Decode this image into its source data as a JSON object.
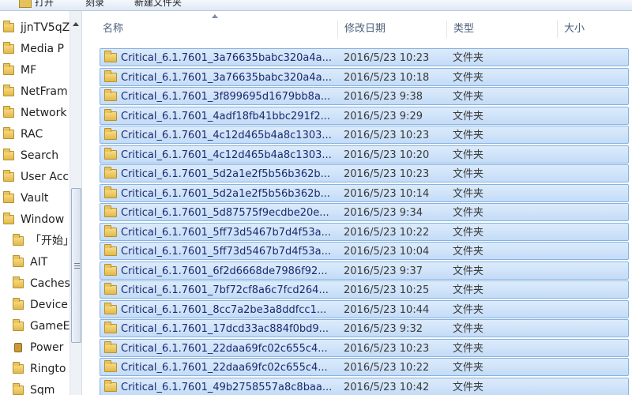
{
  "toolbar": {
    "open_label": "打开",
    "burn_label": "刻录",
    "new_folder_label": "新建文件夹"
  },
  "nav": {
    "items": [
      {
        "label": "jjnTV5qZ",
        "icon": "folder-icon",
        "level": 0
      },
      {
        "label": "Media P",
        "icon": "folder-icon",
        "level": 0
      },
      {
        "label": "MF",
        "icon": "folder-icon",
        "level": 0
      },
      {
        "label": "NetFram",
        "icon": "folder-icon",
        "level": 0
      },
      {
        "label": "Network",
        "icon": "folder-icon",
        "level": 0
      },
      {
        "label": "RAC",
        "icon": "folder-icon",
        "level": 0
      },
      {
        "label": "Search",
        "icon": "folder-icon",
        "level": 0
      },
      {
        "label": "User Acc",
        "icon": "folder-icon",
        "level": 0
      },
      {
        "label": "Vault",
        "icon": "folder-icon",
        "level": 0
      },
      {
        "label": "Window",
        "icon": "folder-icon",
        "level": 0
      },
      {
        "label": "「开始」",
        "icon": "folder-icon",
        "level": 1
      },
      {
        "label": "AIT",
        "icon": "folder-icon",
        "level": 1
      },
      {
        "label": "Caches",
        "icon": "folder-icon",
        "level": 1
      },
      {
        "label": "Device",
        "icon": "folder-icon",
        "level": 1
      },
      {
        "label": "GameE",
        "icon": "folder-icon",
        "level": 1
      },
      {
        "label": "Power",
        "icon": "locked-folder-icon",
        "level": 1
      },
      {
        "label": "Ringto",
        "icon": "folder-icon",
        "level": 1
      },
      {
        "label": "Sqm",
        "icon": "folder-icon",
        "level": 1
      }
    ]
  },
  "columns": {
    "name": "名称",
    "date": "修改日期",
    "type": "类型",
    "size": "大小"
  },
  "files": [
    {
      "name": "Critical_6.1.7601_3a76635babc320a4a...",
      "date": "2016/5/23 10:23",
      "type": "文件夹"
    },
    {
      "name": "Critical_6.1.7601_3a76635babc320a4a...",
      "date": "2016/5/23 10:18",
      "type": "文件夹"
    },
    {
      "name": "Critical_6.1.7601_3f899695d1679bb8a...",
      "date": "2016/5/23 9:38",
      "type": "文件夹"
    },
    {
      "name": "Critical_6.1.7601_4adf18fb41bbc291f2...",
      "date": "2016/5/23 9:29",
      "type": "文件夹"
    },
    {
      "name": "Critical_6.1.7601_4c12d465b4a8c1303...",
      "date": "2016/5/23 10:23",
      "type": "文件夹"
    },
    {
      "name": "Critical_6.1.7601_4c12d465b4a8c1303...",
      "date": "2016/5/23 10:20",
      "type": "文件夹"
    },
    {
      "name": "Critical_6.1.7601_5d2a1e2f5b56b362b...",
      "date": "2016/5/23 10:23",
      "type": "文件夹"
    },
    {
      "name": "Critical_6.1.7601_5d2a1e2f5b56b362b...",
      "date": "2016/5/23 10:14",
      "type": "文件夹"
    },
    {
      "name": "Critical_6.1.7601_5d87575f9ecdbe20e...",
      "date": "2016/5/23 9:34",
      "type": "文件夹"
    },
    {
      "name": "Critical_6.1.7601_5ff73d5467b7d4f53a...",
      "date": "2016/5/23 10:22",
      "type": "文件夹"
    },
    {
      "name": "Critical_6.1.7601_5ff73d5467b7d4f53a...",
      "date": "2016/5/23 10:04",
      "type": "文件夹"
    },
    {
      "name": "Critical_6.1.7601_6f2d6668de7986f92...",
      "date": "2016/5/23 9:37",
      "type": "文件夹"
    },
    {
      "name": "Critical_6.1.7601_7bf72cf8a6c7fcd264...",
      "date": "2016/5/23 10:25",
      "type": "文件夹"
    },
    {
      "name": "Critical_6.1.7601_8cc7a2be3a8ddfcc1...",
      "date": "2016/5/23 10:44",
      "type": "文件夹"
    },
    {
      "name": "Critical_6.1.7601_17dcd33ac884f0bd9...",
      "date": "2016/5/23 9:32",
      "type": "文件夹"
    },
    {
      "name": "Critical_6.1.7601_22daa69fc02c655c4...",
      "date": "2016/5/23 10:23",
      "type": "文件夹"
    },
    {
      "name": "Critical_6.1.7601_22daa69fc02c655c4...",
      "date": "2016/5/23 10:22",
      "type": "文件夹"
    },
    {
      "name": "Critical_6.1.7601_49b2758557a8c8baa...",
      "date": "2016/5/23 10:42",
      "type": "文件夹"
    }
  ]
}
